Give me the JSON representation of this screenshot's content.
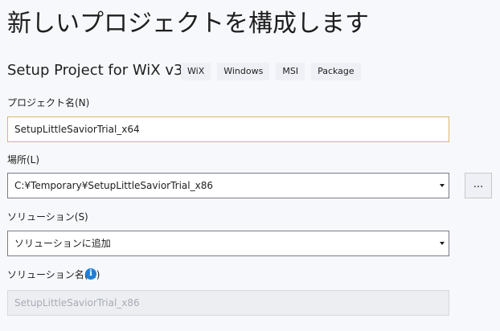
{
  "header": {
    "title": "新しいプロジェクトを構成します",
    "template_name": "Setup Project for WiX v3",
    "tags": [
      "WiX",
      "Windows",
      "MSI",
      "Package"
    ]
  },
  "form": {
    "project_name": {
      "label": "プロジェクト名(N)",
      "value": "SetupLittleSaviorTrial_x64"
    },
    "location": {
      "label": "場所(L)",
      "value": "C:¥Temporary¥SetupLittleSaviorTrial_x86",
      "browse_label": "..."
    },
    "solution": {
      "label": "ソリューション(S)",
      "value": "ソリューションに追加"
    },
    "solution_name": {
      "label": "ソリューション名(M)",
      "value": "SetupLittleSaviorTrial_x86",
      "info_icon": "info-icon",
      "info_glyph": "i"
    }
  },
  "colors": {
    "background": "#f7f8fb",
    "focus_border": "#d9b76b",
    "info_blue": "#1e7fd6",
    "disabled_text": "#a7abb3"
  }
}
